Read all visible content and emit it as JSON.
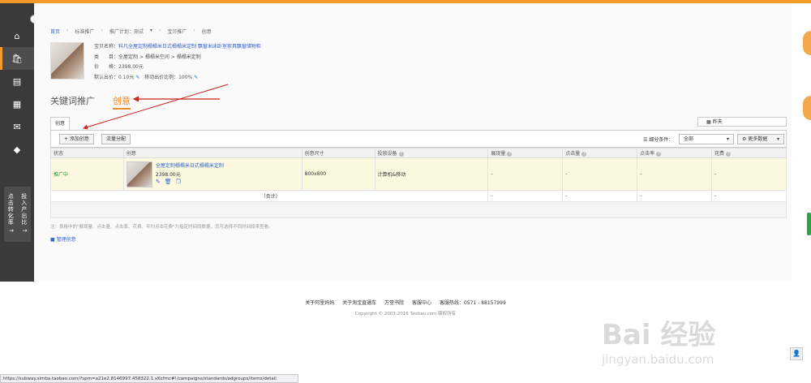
{
  "sidebar": {
    "toggle": "›",
    "items": [
      "⌂",
      "🛍",
      "▤",
      "▦",
      "✉",
      "◆"
    ],
    "metrics": {
      "col1": "点击转化率 ↑",
      "col2": "投入产出比 ↑"
    }
  },
  "breadcrumb": [
    "首页",
    "标准推广",
    "推广计划：测试",
    "宝贝推广",
    "创意"
  ],
  "product": {
    "name_label": "宝贝名称：",
    "name": "科凡全屋定制榻榻米日式榻榻米定制 飘窗米床卧室家具飘窗储物柜",
    "category_label": "类　　目：",
    "category": "全屋定制 > 榻榻米空间 > 榻榻米定制",
    "price_label": "价　　格：",
    "price": "2398.00元",
    "bid_label": "默认出价：",
    "bid": "0.10元",
    "mobile_label": "移动出价比例：",
    "mobile": "100%"
  },
  "tabs": {
    "keyword": "关键词推广",
    "creative": "创意"
  },
  "subtab": "创意",
  "yesterday": "昨天",
  "toolbar": {
    "add_creative": "+ 添加创意",
    "traffic": "流量分配",
    "filter_label": "细分条件：",
    "filter_value": "全部",
    "more_data": "更多数据"
  },
  "table": {
    "headers": [
      "状态",
      "创意",
      "创意尺寸",
      "投放设备",
      "展现量",
      "点击量",
      "点击率",
      "花费"
    ],
    "row": {
      "status": "推广中",
      "creative_name": "全屋定制榻榻米日式榻榻米定制",
      "creative_price": "2398.00元",
      "size": "800x800",
      "device": "计算机&移动",
      "impressions": "-",
      "clicks": "-",
      "ctr": "-",
      "cost": "-"
    },
    "total": {
      "label": "（合计）",
      "impressions": "-",
      "clicks": "-",
      "ctr": "-",
      "cost": "-"
    }
  },
  "note": "注：表格中的\"展现量、点击量、点击率、花费、平均点击花费\"为指定时间段数据，您可选择不同时间段来查看。",
  "manage": "管理创意",
  "footer": {
    "links": [
      "关于阿里妈妈",
      "关于淘宝直通车",
      "万堂书院",
      "客服中心",
      "客服热线：0571 - 88157999"
    ],
    "copyright": "Copyright © 2003-2016 Taobao.com 版权所有"
  },
  "statusbar": "https://subway.simba.taobao.com/?spm=a21e2.8146997.458322.1.xKcfmc#!/campaigns/standards/adgroups/items/detail",
  "watermark": {
    "brand": "Bai 经验",
    "url": "jingyan.baidu.com"
  },
  "colors": {
    "accent": "#f49a2a",
    "sidebar": "#3a3a3a",
    "link": "#3366cc",
    "status_green": "#2a8a2a",
    "arrow": "#cc2222"
  }
}
